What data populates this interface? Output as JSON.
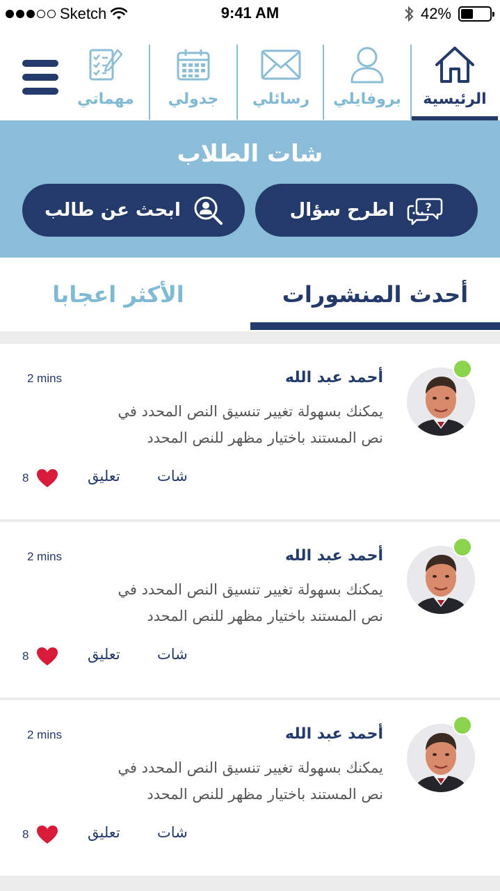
{
  "status_bar": {
    "carrier": "Sketch",
    "time": "9:41 AM",
    "battery_percent": "42%",
    "battery_level": 0.42,
    "signal_filled": 3,
    "signal_total": 5
  },
  "nav": {
    "items": [
      {
        "label": "الرئيسية",
        "icon": "home-icon",
        "active": true
      },
      {
        "label": "بروفايلي",
        "icon": "user-icon",
        "active": false
      },
      {
        "label": "رسائلي",
        "icon": "envelope-icon",
        "active": false
      },
      {
        "label": "جدولي",
        "icon": "calendar-icon",
        "active": false
      },
      {
        "label": "مهماتي",
        "icon": "tasks-icon",
        "active": false
      }
    ],
    "menu_icon": "hamburger-menu-icon"
  },
  "hero": {
    "title": "شات الطلاب",
    "ask_button": "اطرح سؤال",
    "search_button": "ابحث عن طالب"
  },
  "tabs": {
    "latest": "أحدث المنشورات",
    "liked": "الأكثر اعجابا",
    "active": "latest"
  },
  "colors": {
    "primary": "#243a6b",
    "accent": "#8bbdd8",
    "online": "#8bd34c",
    "heart": "#d71c3a"
  },
  "posts": [
    {
      "author": "أحمد عبد الله",
      "time": "2 mins",
      "line1": "يمكنك بسهولة تغيير تنسيق النص المحدد في",
      "line2": "نص المستند باختيار مظهر للنص المحدد",
      "likes": "8",
      "comment": "تعليق",
      "share": "شات",
      "online": true
    },
    {
      "author": "أحمد عبد الله",
      "time": "2 mins",
      "line1": "يمكنك بسهولة تغيير تنسيق النص المحدد في",
      "line2": "نص المستند باختيار مظهر للنص المحدد",
      "likes": "8",
      "comment": "تعليق",
      "share": "شات",
      "online": true
    },
    {
      "author": "أحمد عبد الله",
      "time": "2 mins",
      "line1": "يمكنك بسهولة تغيير تنسيق النص المحدد في",
      "line2": "نص المستند باختيار مظهر للنص المحدد",
      "likes": "8",
      "comment": "تعليق",
      "share": "شات",
      "online": true
    }
  ]
}
